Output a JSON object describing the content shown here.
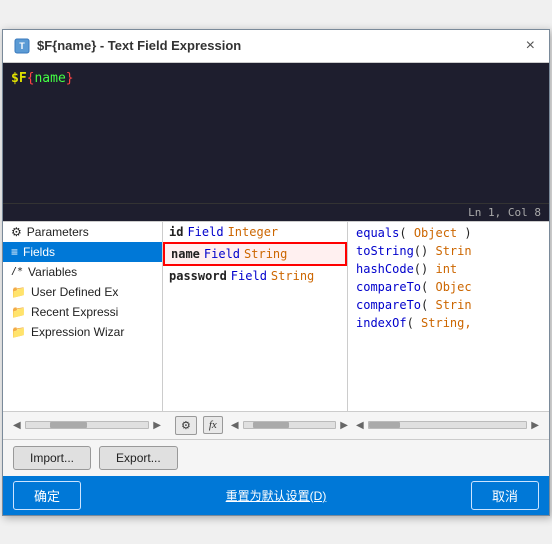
{
  "window": {
    "title": "$F{name} - Text Field Expression",
    "close_label": "×"
  },
  "editor": {
    "content_dollar": "$F",
    "content_brace_open": "{",
    "content_name": "name",
    "content_brace_close": "}",
    "status": "Ln 1, Col 8"
  },
  "left_panel": {
    "items": [
      {
        "id": "parameters",
        "icon": "⚙",
        "label": "Parameters"
      },
      {
        "id": "fields",
        "icon": "≡",
        "label": "Fields",
        "selected": true
      },
      {
        "id": "variables",
        "icon": "/*",
        "label": "Variables"
      },
      {
        "id": "user-defined",
        "icon": "📁",
        "label": "User Defined Ex"
      },
      {
        "id": "recent",
        "icon": "📁",
        "label": "Recent Expressi"
      },
      {
        "id": "wizard",
        "icon": "📁",
        "label": "Expression Wizar"
      }
    ]
  },
  "middle_panel": {
    "rows": [
      {
        "id": "id-row",
        "name": "id",
        "keyword": "Field",
        "type": "Integer",
        "highlighted": false
      },
      {
        "id": "name-row",
        "name": "name",
        "keyword": "Field",
        "type": "String",
        "highlighted": true
      },
      {
        "id": "password-row",
        "name": "password",
        "keyword": "Field",
        "type": "String",
        "highlighted": false
      }
    ]
  },
  "right_panel": {
    "methods": [
      {
        "id": "equals",
        "name": "equals",
        "params": "Object",
        "returns": ""
      },
      {
        "id": "tostring",
        "name": "toString",
        "params": "",
        "returns": "Strin"
      },
      {
        "id": "hashcode",
        "name": "hashCode",
        "params": "",
        "returns": "int"
      },
      {
        "id": "compareto1",
        "name": "compareTo",
        "params": "Objec",
        "returns": ""
      },
      {
        "id": "compareto2",
        "name": "compareTo",
        "params": "Strin",
        "returns": ""
      },
      {
        "id": "indexof",
        "name": "indexOf",
        "params": "String,",
        "returns": ""
      }
    ]
  },
  "toolbar": {
    "import_label": "Import...",
    "export_label": "Export...",
    "icons": [
      "⚙",
      "fx"
    ]
  },
  "bottom_bar": {
    "confirm_label": "确定",
    "reset_label": "重置为默认设置(D)",
    "cancel_label": "取消"
  }
}
